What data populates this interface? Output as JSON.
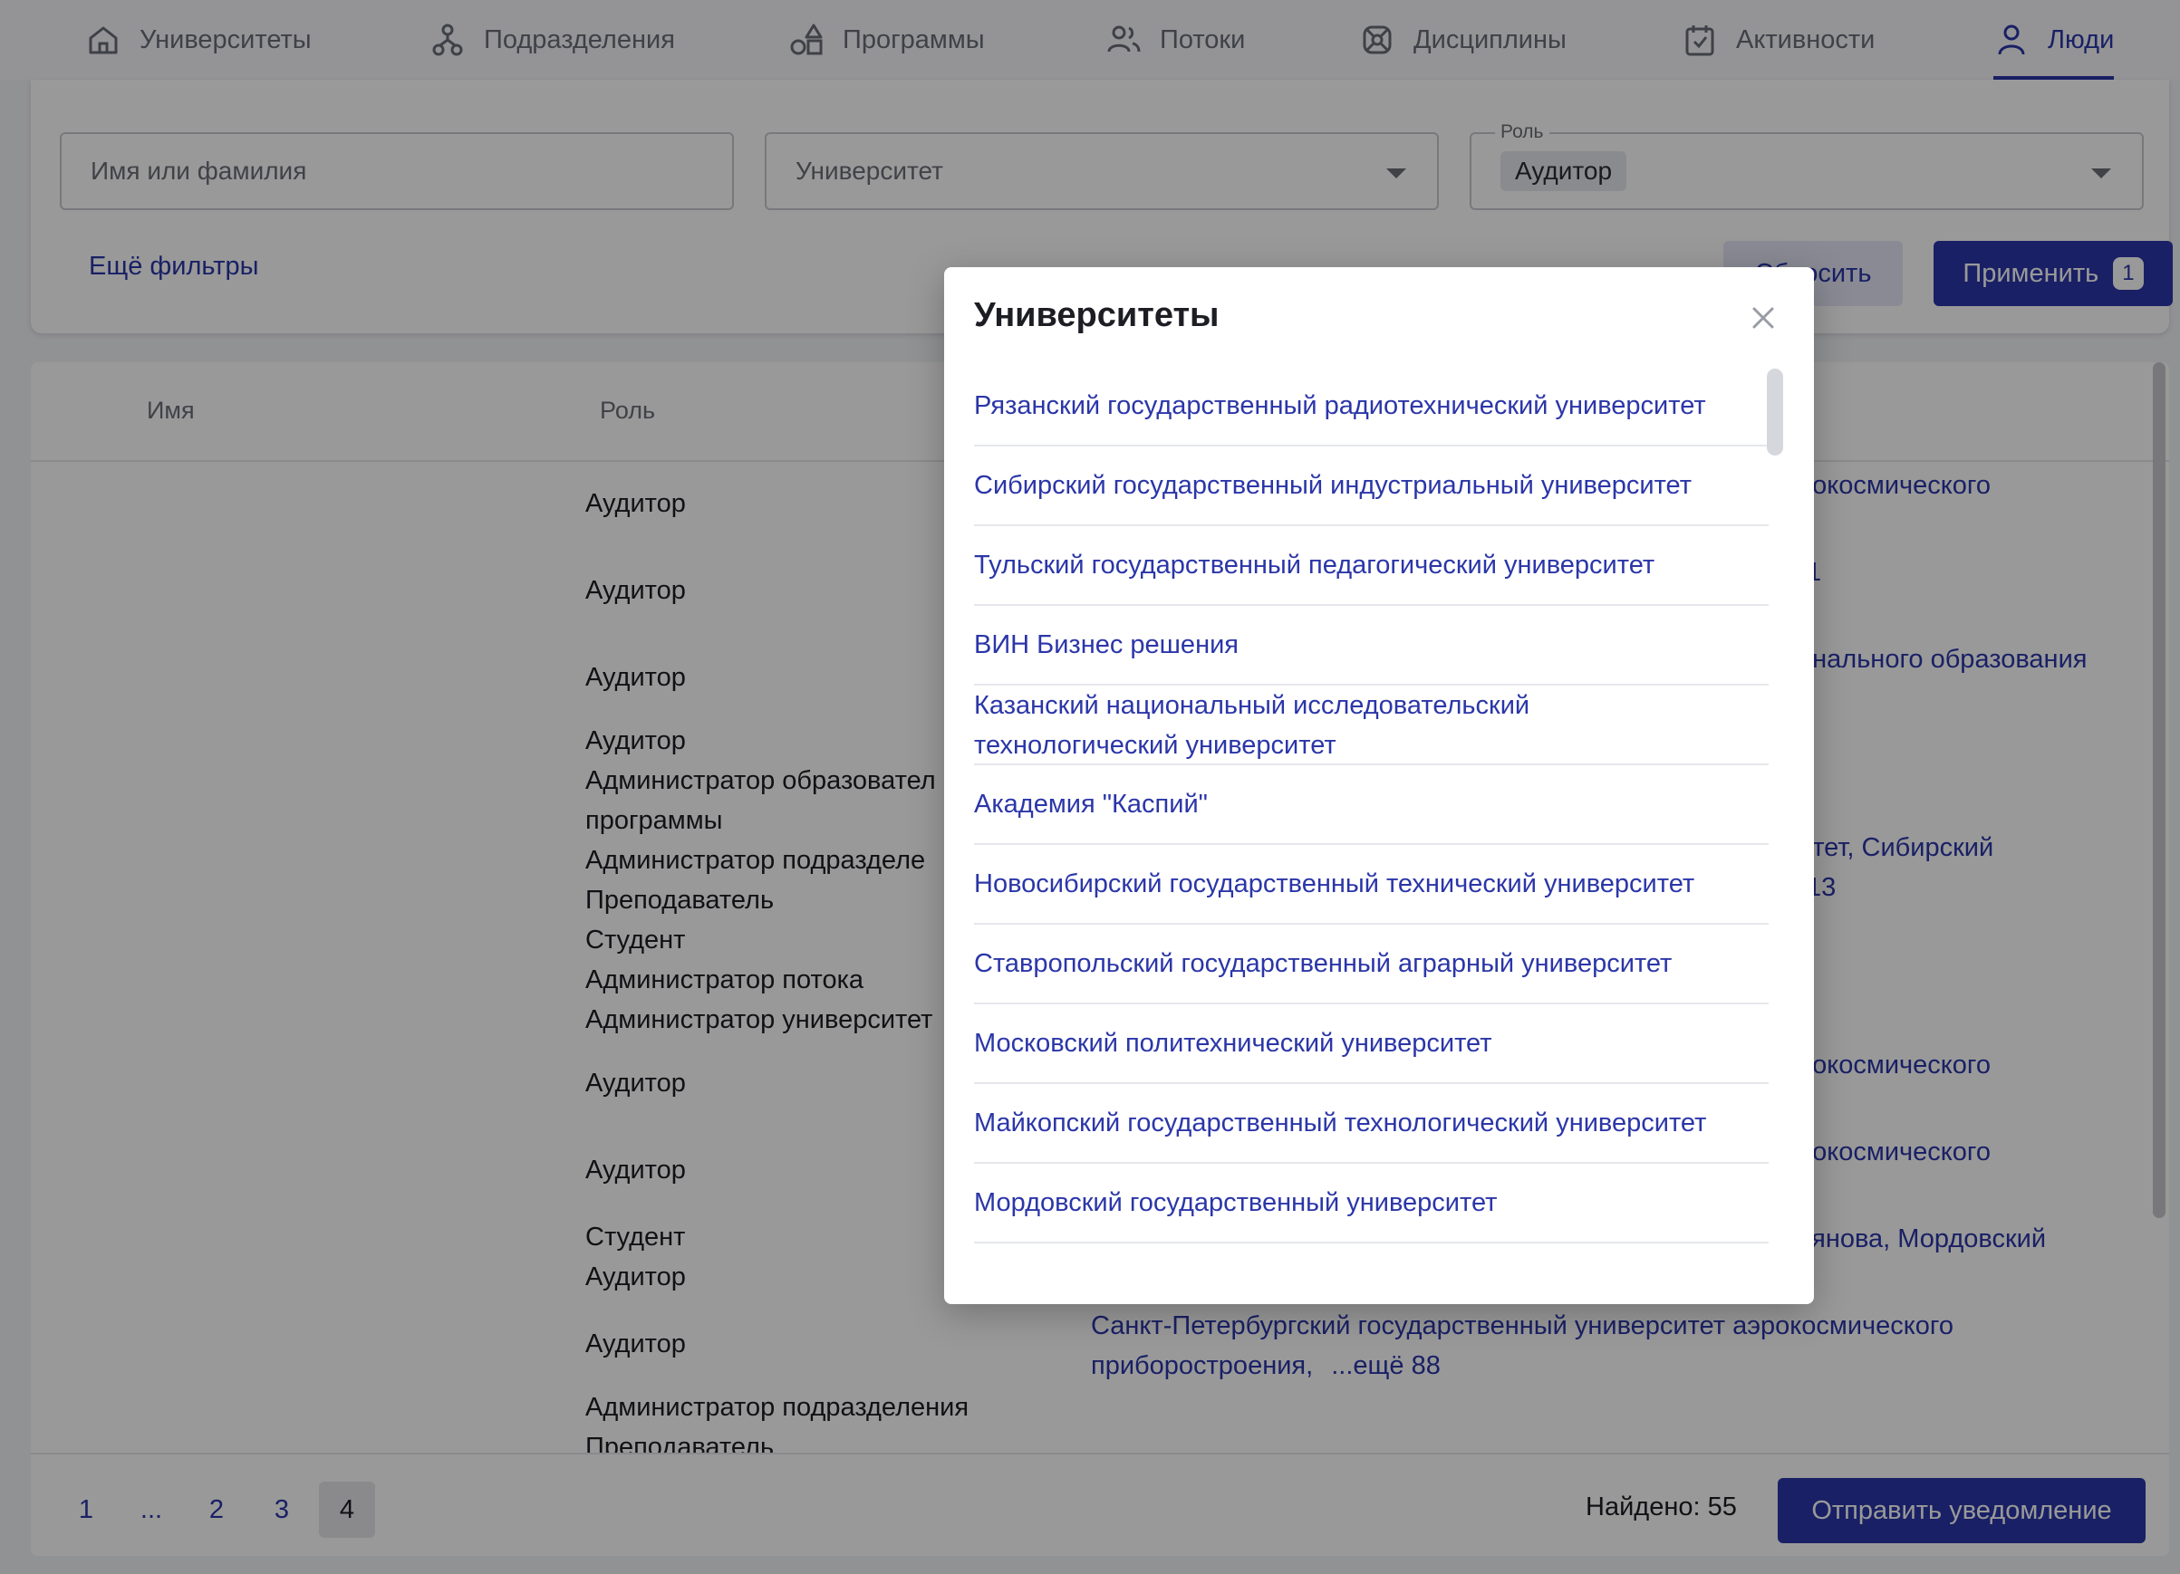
{
  "nav": {
    "tabs": [
      {
        "label": "Университеты",
        "icon": "university-icon"
      },
      {
        "label": "Подразделения",
        "icon": "subdivisions-icon"
      },
      {
        "label": "Программы",
        "icon": "programs-icon"
      },
      {
        "label": "Потоки",
        "icon": "streams-icon"
      },
      {
        "label": "Дисциплины",
        "icon": "disciplines-icon"
      },
      {
        "label": "Активности",
        "icon": "activities-icon"
      },
      {
        "label": "Люди",
        "icon": "person-icon",
        "active": true
      }
    ]
  },
  "filters": {
    "name_placeholder": "Имя или фамилия",
    "university_placeholder": "Университет",
    "role_legend": "Роль",
    "role_value": "Аудитор",
    "more_filters": "Ещё фильтры",
    "reset_label": "Сбросить",
    "apply_label": "Применить",
    "apply_count": "1"
  },
  "table": {
    "headers": {
      "name": "Имя",
      "role": "Роль"
    },
    "roles": [
      [
        "Аудитор"
      ],
      [
        "Аудитор"
      ],
      [
        "Аудитор"
      ],
      [
        "Аудитор",
        "Администратор образовател",
        "программы",
        "Администратор подразделе",
        "Преподаватель",
        "Студент",
        "Администратор потока",
        "Администратор университет"
      ],
      [
        "Аудитор"
      ],
      [
        "Аудитор"
      ],
      [
        "Студент",
        "Аудитор"
      ],
      [
        "Аудитор"
      ],
      [
        "Администратор подразделения",
        "Преподаватель"
      ]
    ],
    "universities_visible": [
      "рокосмического",
      "1",
      "онального образования",
      "итет,  Сибирский",
      "13",
      "рокосмического",
      "рокосмического",
      "ьянова,  Мордовский"
    ],
    "last_row_universities": {
      "line1": "Санкт-Петербургский государственный университет аэрокосмического",
      "line2": "приборостроения,",
      "more": "...ещё 88"
    }
  },
  "pagination": {
    "pages": [
      "1",
      "...",
      "2",
      "3",
      "4"
    ],
    "current": "4"
  },
  "footer": {
    "found": "Найдено: 55",
    "notify_label": "Отправить уведомление"
  },
  "modal": {
    "title": "Университеты",
    "items": [
      "Рязанский государственный радиотехнический университет",
      "Сибирский государственный индустриальный университет",
      "Тульский государственный педагогический университет",
      "ВИН Бизнес решения",
      "Казанский национальный исследовательский технологический университет",
      "Академия \"Каспий\"",
      "Новосибирский государственный технический университет",
      "Ставропольский государственный аграрный университет",
      "Московский политехнический университет",
      "Майкопский государственный технологический университет",
      "Мордовский государственный университет"
    ]
  },
  "colors": {
    "accent": "#2b36a8",
    "overlay": "rgba(0,0,0,0.40)"
  }
}
